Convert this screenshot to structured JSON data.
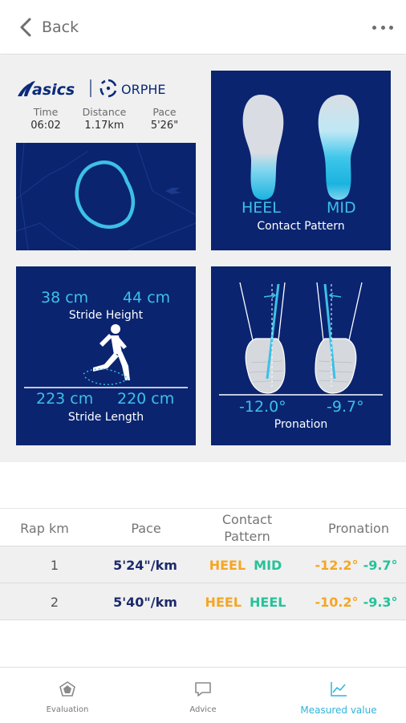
{
  "header": {
    "back_label": "Back",
    "back_icon": "chevron-left-icon",
    "more_icon": "more-dots-icon"
  },
  "brand": {
    "asics": "asics",
    "orphe": "ORPHE"
  },
  "stats": [
    {
      "label": "Time",
      "value": "06:02"
    },
    {
      "label": "Distance",
      "value": "1.17km"
    },
    {
      "label": "Pace",
      "value": "5'26\""
    }
  ],
  "contact": {
    "left": "HEEL",
    "right": "MID",
    "title": "Contact Pattern"
  },
  "stride": {
    "height_left": "38 cm",
    "height_right": "44 cm",
    "height_title": "Stride Height",
    "length_left": "223 cm",
    "length_right": "220 cm",
    "length_title": "Stride Length"
  },
  "pronation": {
    "left": "-12.0°",
    "right": "-9.7°",
    "title": "Pronation"
  },
  "table": {
    "headers": {
      "lap": "Rap km",
      "pace": "Pace",
      "contact": "Contact Pattern",
      "pronation": "Pronation"
    },
    "rows": [
      {
        "lap": "1",
        "pace": "5'24\"/km",
        "contact_left": "HEEL",
        "contact_right": "MID",
        "pron_left": "-12.2°",
        "pron_right": "-9.7°"
      },
      {
        "lap": "2",
        "pace": "5'40\"/km",
        "contact_left": "HEEL",
        "contact_right": "HEEL",
        "pron_left": "-10.2°",
        "pron_right": "-9.3°"
      }
    ]
  },
  "tabs": [
    {
      "label": "Evaluation",
      "icon": "evaluation-icon",
      "active": false
    },
    {
      "label": "Advice",
      "icon": "speech-bubble-icon",
      "active": false
    },
    {
      "label": "Measured value",
      "icon": "line-chart-icon",
      "active": true
    }
  ],
  "colors": {
    "card_bg": "#0a2470",
    "accent_cyan": "#3cc0e6",
    "orange": "#f5a623",
    "green": "#26c29a",
    "active_tab": "#2fb4dc"
  }
}
